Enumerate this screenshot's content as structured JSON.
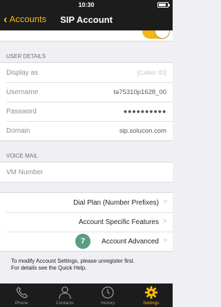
{
  "status_bar": {
    "time": "10:30",
    "battery_level": 0.85
  },
  "nav": {
    "back_label": "Accounts",
    "title": "SIP Account"
  },
  "user_details": {
    "header": "USER DETAILS",
    "rows": [
      {
        "label": "Display as",
        "value": "[Caller ID]"
      },
      {
        "label": "Username",
        "value": "ta75310p1628_00"
      },
      {
        "label": "Password",
        "value": "●●●●●●●●●●"
      },
      {
        "label": "Domain",
        "value": "sip.solucon.com"
      }
    ]
  },
  "voice_mail": {
    "header": "VOICE MAIL",
    "rows": [
      {
        "label": "VM Number",
        "value": ""
      }
    ]
  },
  "actions": [
    {
      "label": "Dial Plan (Number Prefixes)"
    },
    {
      "label": "Account Specific Features"
    },
    {
      "label": "Account Advanced",
      "badge": "7"
    }
  ],
  "note": {
    "line1": "To modify Account Settings, please unregister first.",
    "line2": "For details see the Quick Help."
  },
  "tabs": [
    {
      "label": "Phone",
      "icon": "phone-icon",
      "active": false
    },
    {
      "label": "Contacts",
      "icon": "contacts-icon",
      "active": false
    },
    {
      "label": "History",
      "icon": "history-icon",
      "active": false
    },
    {
      "label": "Settings",
      "icon": "settings-icon",
      "active": true
    }
  ],
  "colors": {
    "accent": "#f3b814",
    "bar_bg": "#1c1c1c",
    "badge": "#5a9e80"
  }
}
